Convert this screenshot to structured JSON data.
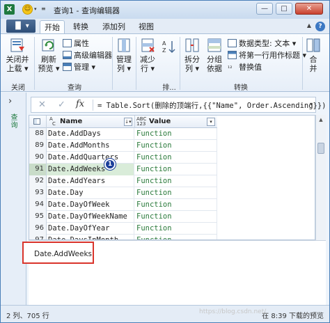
{
  "window": {
    "app_icon": "excel-icon",
    "title": "查询1 - 查询编辑器",
    "controls": {
      "minimize": "—",
      "maximize": "□",
      "close": "✕"
    }
  },
  "quick_access": {
    "smiley": "☺",
    "dropdown": "▾",
    "more": "≡"
  },
  "tabs": {
    "file": "▐▌ ▾",
    "items": [
      "开始",
      "转换",
      "添加列",
      "视图"
    ],
    "active_index": 0
  },
  "ribbon": {
    "close_group": {
      "button": [
        "关闭并",
        "上载 ▾"
      ],
      "label": "关闭"
    },
    "query_group": {
      "refresh": [
        "刷新",
        "预览 ▾"
      ],
      "properties": "属性",
      "advanced_editor": "高级编辑器",
      "manage": "管理 ▾",
      "label": "查询"
    },
    "manage_columns": {
      "button": [
        "管理",
        "列 ▾"
      ]
    },
    "reduce_rows": {
      "button": [
        "减少",
        "行 ▾"
      ]
    },
    "sort_group_label": "排...",
    "split": {
      "button": [
        "拆分",
        "列 ▾"
      ]
    },
    "group_by": {
      "button": [
        "分组",
        "依据"
      ]
    },
    "data_type": "数据类型: 文本 ▾",
    "first_row_header": "将第一行用作标题 ▾",
    "replace_values": "替换值",
    "transform_label": "转换",
    "combine": {
      "button": [
        "合",
        "并"
      ]
    }
  },
  "sidebar": {
    "chevron": "›",
    "label": "查询"
  },
  "formula_bar": {
    "cancel": "✕",
    "commit": "✓",
    "fx": "fx",
    "formula": "= Table.Sort(删除的顶端行,{{\"Name\", Order.Ascending}})"
  },
  "grid": {
    "columns": [
      {
        "type_badge": [
          "A",
          "C"
        ],
        "name": "Name",
        "sort_indicator": "↓▾"
      },
      {
        "type_badge": [
          "ABC",
          "123"
        ],
        "name": "Value",
        "sort_indicator": "▾"
      }
    ],
    "rows": [
      {
        "num": "88",
        "name": "Date.AddDays",
        "value": "Function"
      },
      {
        "num": "89",
        "name": "Date.AddMonths",
        "value": "Function"
      },
      {
        "num": "90",
        "name": "Date.AddQuarters",
        "value": "Function"
      },
      {
        "num": "91",
        "name": "Date.AddWeeks",
        "value": "Function"
      },
      {
        "num": "92",
        "name": "Date.AddYears",
        "value": "Function"
      },
      {
        "num": "93",
        "name": "Date.Day",
        "value": "Function"
      },
      {
        "num": "94",
        "name": "Date.DayOfWeek",
        "value": "Function"
      },
      {
        "num": "95",
        "name": "Date.DayOfWeekName",
        "value": "Function"
      },
      {
        "num": "96",
        "name": "Date.DayOfYear",
        "value": "Function"
      },
      {
        "num": "97",
        "name": "Date.DaysInMonth",
        "value": "Function"
      }
    ],
    "selected_row": "91",
    "badge": "1"
  },
  "preview": {
    "value": "Date.AddWeeks"
  },
  "status": {
    "left": "2 列、705 行",
    "right": "在 8:39 下载的预览"
  },
  "watermark": "https://blog.csdn.net/",
  "colors": {
    "accent": "#4a7fb8",
    "highlight": "#d9342b",
    "function_text": "#2a7a3b",
    "selected_row": "#d9ecd9"
  }
}
